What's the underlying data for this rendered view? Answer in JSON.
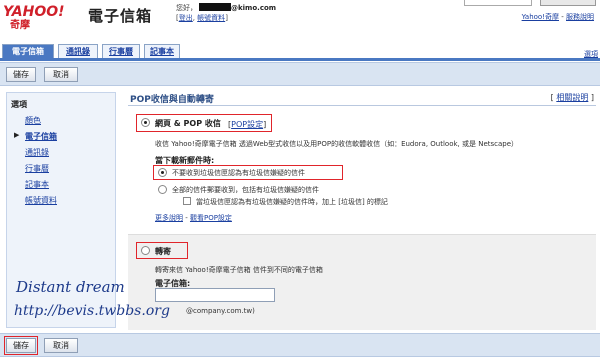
{
  "header": {
    "logo_text": "YAHOO!",
    "logo_sub": "奇摩",
    "app_title": "電子信箱",
    "greeting": "您好，",
    "email_domain": "@kimo.com",
    "logout": "登出",
    "account_settings": "帳號資料",
    "link_yahoo": "Yahoo!奇摩",
    "link_help": "服務說明"
  },
  "tabs": [
    {
      "label": "電子信箱"
    },
    {
      "label": "通訊錄"
    },
    {
      "label": "行事曆"
    },
    {
      "label": "記事本"
    }
  ],
  "tabs_right": "選項",
  "toolbar": {
    "save": "儲存",
    "cancel": "取消"
  },
  "sidebar": {
    "heading": "選項",
    "items": [
      {
        "label": "顏色"
      },
      {
        "label": "電子信箱"
      },
      {
        "label": "通訊錄"
      },
      {
        "label": "行事曆"
      },
      {
        "label": "記事本"
      },
      {
        "label": "帳號資料"
      }
    ]
  },
  "main": {
    "title": "POP收信與自動轉寄",
    "help": "相關說明",
    "pop": {
      "label": "網頁 & POP 收信",
      "settings_link": "POP設定",
      "desc": "收信 Yahoo!奇摩電子信箱 透過Web型式收信以及用POP的收信軟體收信（如：Eudora, Outlook, 或是 Netscape）",
      "download_heading": "當下載新郵件時:",
      "option1": "不要收到垃圾信匣認為有垃圾信嫌疑的信件",
      "option2": "全部的信件郵要收到，包括有垃圾信嫌疑的信件",
      "option2_sub": "當垃圾信匣認為有垃圾信嫌疑的信件時，加上 [垃圾信] 的標記",
      "more_link": "更多說明",
      "separator": " - ",
      "view_link": "觀看POP設定"
    },
    "forward": {
      "label": "轉寄",
      "desc": "轉寄來信 Yahoo!奇摩電子信箱 信件到不同的電子信箱",
      "email_label": "電子信箱:",
      "email_value": "",
      "example": "@company.com.tw)"
    }
  },
  "watermark": {
    "line1": "Distant dream",
    "line2": "http://bevis.twbbs.org"
  },
  "colors": {
    "accent": "#4a78c2",
    "highlight": "#e0252b",
    "link": "#1a3fa0"
  }
}
